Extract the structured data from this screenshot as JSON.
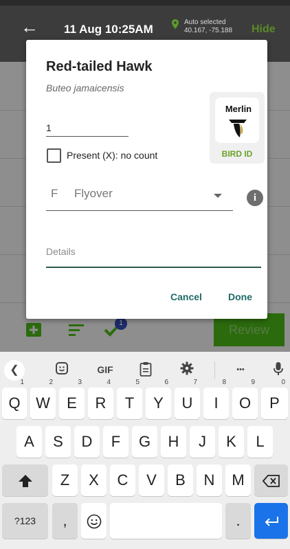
{
  "header": {
    "datetime": "11 Aug 10:25AM",
    "location_status": "Auto selected",
    "location_coords": "40.167, -75.188",
    "hide_label": "Hide"
  },
  "background": {
    "review_label": "Review",
    "badge_count": "1"
  },
  "dialog": {
    "common_name": "Red-tailed Hawk",
    "scientific_name": "Buteo jamaicensis",
    "count_value": "1",
    "present_label": "Present (X): no count",
    "present_checked": false,
    "merlin_brand": "Merlin",
    "merlin_bird_id": "BIRD ID",
    "breeding_code": "F",
    "breeding_label": "Flyover",
    "details_placeholder": "Details",
    "cancel_label": "Cancel",
    "done_label": "Done"
  },
  "keyboard": {
    "toolbar": {
      "gif_label": "GIF",
      "more_label": "•••"
    },
    "row1": [
      {
        "key": "Q",
        "sup": "1"
      },
      {
        "key": "W",
        "sup": "2"
      },
      {
        "key": "E",
        "sup": "3"
      },
      {
        "key": "R",
        "sup": "4"
      },
      {
        "key": "T",
        "sup": "5"
      },
      {
        "key": "Y",
        "sup": "6"
      },
      {
        "key": "U",
        "sup": "7"
      },
      {
        "key": "I",
        "sup": "8"
      },
      {
        "key": "O",
        "sup": "9"
      },
      {
        "key": "P",
        "sup": "0"
      }
    ],
    "row2": [
      "A",
      "S",
      "D",
      "F",
      "G",
      "H",
      "J",
      "K",
      "L"
    ],
    "row3": [
      "Z",
      "X",
      "C",
      "V",
      "B",
      "N",
      "M"
    ],
    "symbols_label": "?123",
    "comma_label": ",",
    "period_label": "."
  },
  "colors": {
    "accent": "#1f6b65",
    "merlin_green": "#6aa22a",
    "enter_key": "#1a73e8"
  }
}
